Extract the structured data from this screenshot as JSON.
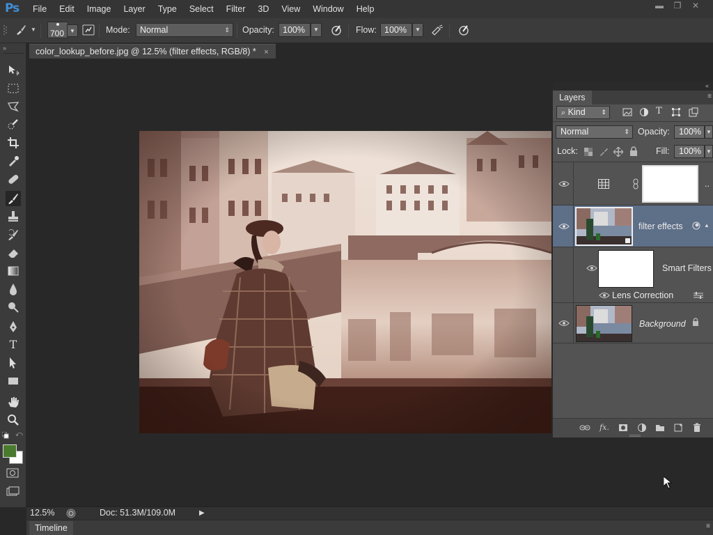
{
  "app": {
    "logo": "Ps"
  },
  "menu": [
    "File",
    "Edit",
    "Image",
    "Layer",
    "Type",
    "Select",
    "Filter",
    "3D",
    "View",
    "Window",
    "Help"
  ],
  "window_controls": {
    "minimize": "▬",
    "restore": "❐",
    "close": "✕"
  },
  "options": {
    "brush_size": "700",
    "mode_label": "Mode:",
    "mode_value": "Normal",
    "opacity_label": "Opacity:",
    "opacity_value": "100%",
    "flow_label": "Flow:",
    "flow_value": "100%"
  },
  "document_tab": {
    "title": "color_lookup_before.jpg @ 12.5% (filter effects, RGB/8) *",
    "close": "×"
  },
  "tools": [
    "move-tool",
    "marquee-tool",
    "lasso-tool",
    "quick-selection-tool",
    "crop-tool",
    "eyedropper-tool",
    "healing-brush-tool",
    "brush-tool",
    "clone-stamp-tool",
    "history-brush-tool",
    "eraser-tool",
    "gradient-tool",
    "blur-tool",
    "dodge-tool",
    "pen-tool",
    "type-tool",
    "path-selection-tool",
    "shape-tool",
    "hand-tool",
    "zoom-tool"
  ],
  "colors": {
    "foreground": "#4a7a2e",
    "background": "#ffffff",
    "accent_selection": "#5e6f88"
  },
  "layers_panel": {
    "tab_label": "Layers",
    "filter_kind": "Kind",
    "blend_mode": "Normal",
    "opacity_label": "Opacity:",
    "opacity_value": "100%",
    "lock_label": "Lock:",
    "fill_label": "Fill:",
    "fill_value": "100%",
    "layers": [
      {
        "name": "",
        "type": "adjustment-color-lookup",
        "visible": true
      },
      {
        "name": "filter effects",
        "type": "smart-object",
        "visible": true,
        "selected": true
      },
      {
        "name": "Smart Filters",
        "type": "smart-filters-mask",
        "visible": true
      },
      {
        "name": "Lens Correction",
        "type": "smart-filter",
        "visible": true
      },
      {
        "name": "Background",
        "type": "background",
        "visible": true,
        "locked": true
      }
    ]
  },
  "status": {
    "zoom": "12.5%",
    "doc_info": "Doc: 51.3M/109.0M"
  },
  "timeline": {
    "label": "Timeline"
  }
}
